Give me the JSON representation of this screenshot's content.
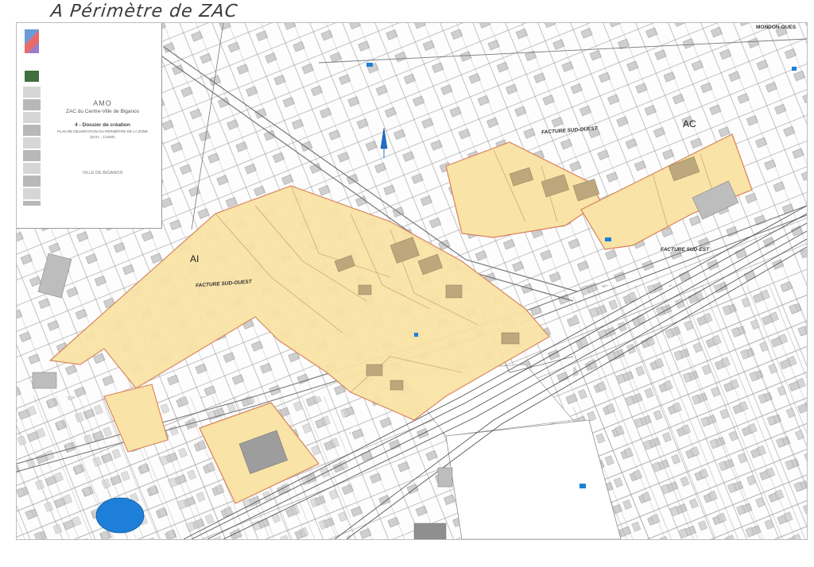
{
  "handwritten_title": "A Périmètre de ZAC",
  "cartouche": {
    "header_small": "",
    "title": "AMO",
    "subtitle": "ZAC du Centre-Ville de Biganos",
    "dossier": "4 - Dossier de création",
    "plan": "PLAN DE DÉLIMITATION DU PÉRIMÈTRE DE LA ZONE",
    "scale": "(ECH. : 1/1000)",
    "client": "VILLE DE BIGANOS",
    "address": ""
  },
  "labels": {
    "section_ai": "AI",
    "section_ac": "AC",
    "facture_sud_ouest_1": "FACTURE SUD-OUEST",
    "facture_sud_ouest_2": "FACTURE SUD-OUEST",
    "facture_sud_est": "FACTURE SUD-EST",
    "mondon_ouest": "MONDON-OUES"
  },
  "colors": {
    "zac_fill": "#f9e3a6",
    "zac_border": "#d8805a",
    "building": "#c9c9c9",
    "building_zac": "#bda77d",
    "water": "#1e7fd8",
    "parcel_line": "#8c8c8c",
    "rail": "#666666"
  },
  "icons": {
    "north_arrow": "north-arrow-icon"
  }
}
